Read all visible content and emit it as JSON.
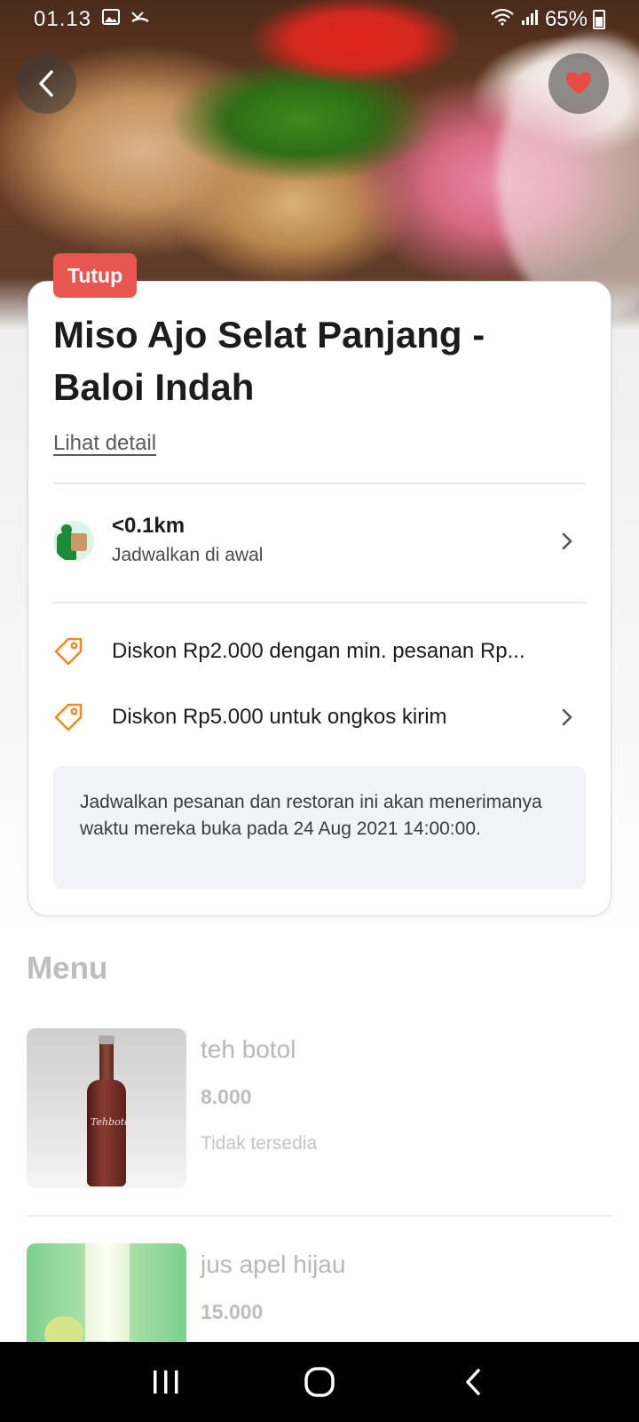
{
  "status_bar": {
    "time": "01.13",
    "battery": "65%",
    "icons": [
      "gallery-icon",
      "missed-call-icon",
      "wifi-icon",
      "signal-icon",
      "battery-icon"
    ]
  },
  "header": {
    "back_icon": "chevron-left-icon",
    "favorite_icon": "heart-icon",
    "favorite_color": "#e84a44"
  },
  "restaurant": {
    "status_badge": "Tutup",
    "status_badge_color": "#e8574f",
    "name": "Miso Ajo Selat Panjang - Baloi Indah",
    "detail_link": "Lihat detail",
    "distance": "<0.1km",
    "delivery_mode": "Jadwalkan di awal",
    "promos": [
      {
        "icon": "discount-tag-icon",
        "text": "Diskon Rp2.000 dengan min. pesanan Rp..."
      },
      {
        "icon": "discount-tag-icon",
        "text": "Diskon Rp5.000 untuk ongkos kirim"
      }
    ],
    "accent_color": "#f08a24",
    "schedule_note": "Jadwalkan pesanan dan restoran ini akan menerimanya waktu mereka buka pada 24 Aug 2021 14:00:00."
  },
  "menu": {
    "heading": "Menu",
    "items": [
      {
        "name": "teh botol",
        "price": "8.000",
        "availability": "Tidak tersedia",
        "label": "Tehbotol"
      },
      {
        "name": "jus apel hijau",
        "price": "15.000"
      }
    ]
  },
  "nav_bar": {
    "buttons": [
      "recent-apps-icon",
      "home-icon",
      "back-icon"
    ]
  }
}
